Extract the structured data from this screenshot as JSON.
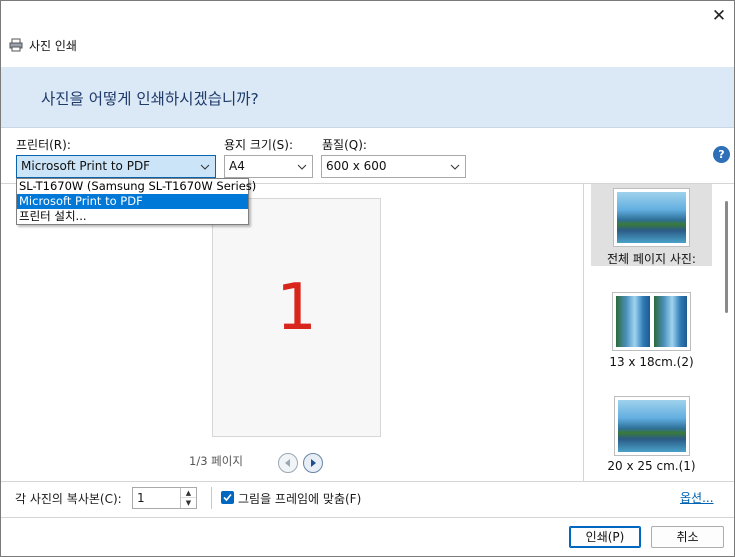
{
  "window": {
    "title": "사진 인쇄",
    "close_label": "✕"
  },
  "header": {
    "question": "사진을 어떻게 인쇄하시겠습니까?"
  },
  "printer": {
    "label": "프린터(R):",
    "selected": "Microsoft Print to PDF",
    "options": [
      "SL-T1670W (Samsung SL-T1670W Series)",
      "Microsoft Print to PDF",
      "프린터 설치..."
    ]
  },
  "paper_size": {
    "label": "용지 크기(S):",
    "selected": "A4"
  },
  "quality": {
    "label": "품질(Q):",
    "selected": "600 x 600"
  },
  "help": {
    "glyph": "?"
  },
  "preview": {
    "page_number": "1",
    "pager_text": "1/3 페이지"
  },
  "layouts": [
    {
      "caption": "전체 페이지 사진:"
    },
    {
      "caption": "13 x 18cm.(2)"
    },
    {
      "caption": "20 x 25 cm.(1)"
    }
  ],
  "bottom": {
    "copies_label": "각 사진의 복사본(C):",
    "copies_value": "1",
    "fit_label": "그림을 프레임에 맞춤(F)",
    "options_link": "옵션..."
  },
  "buttons": {
    "print": "인쇄(P)",
    "cancel": "취소"
  },
  "colors": {
    "header_bg": "#dbe8f5",
    "accent": "#0078d7",
    "page_number": "#d9261c"
  }
}
